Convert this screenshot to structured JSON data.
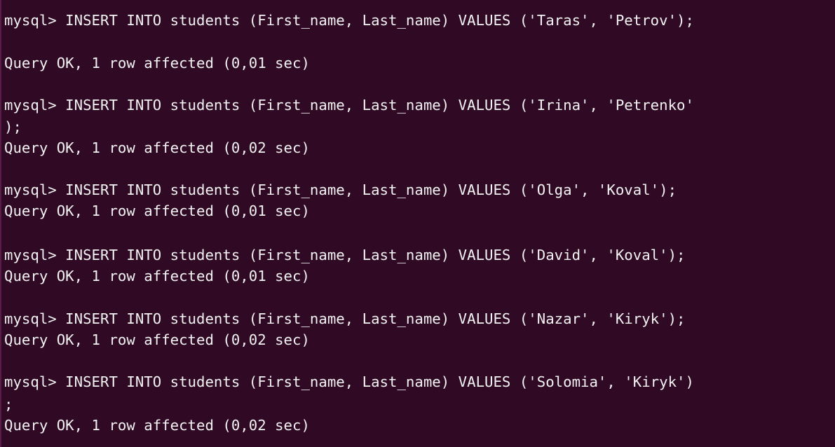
{
  "terminal": {
    "lines": [
      "mysql> INSERT INTO students (First_name, Last_name) VALUES ('Taras', 'Petrov');",
      "Query OK, 1 row affected (0,01 sec)",
      "mysql> INSERT INTO students (First_name, Last_name) VALUES ('Irina', 'Petrenko'",
      ");",
      "Query OK, 1 row affected (0,02 sec)",
      "mysql> INSERT INTO students (First_name, Last_name) VALUES ('Olga', 'Koval');",
      "Query OK, 1 row affected (0,01 sec)",
      "mysql> INSERT INTO students (First_name, Last_name) VALUES ('David', 'Koval');",
      "Query OK, 1 row affected (0,01 sec)",
      "mysql> INSERT INTO students (First_name, Last_name) VALUES ('Nazar', 'Kiryk');",
      "Query OK, 1 row affected (0,02 sec)",
      "mysql> INSERT INTO students (First_name, Last_name) VALUES ('Solomia', 'Kiryk')",
      ";",
      "Query OK, 1 row affected (0,02 sec)"
    ]
  },
  "colors": {
    "background": "#300a24",
    "text": "#f2f2f2"
  }
}
